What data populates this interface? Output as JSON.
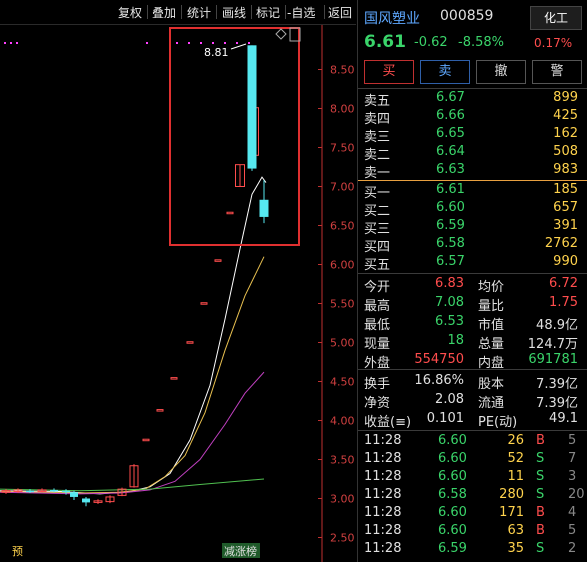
{
  "toolbar": {
    "buttons": [
      "复权",
      "叠加",
      "统计",
      "画线",
      "标记",
      "-自选",
      "返回"
    ]
  },
  "chart": {
    "max_label": "8.81",
    "y_ticks": [
      "8.50",
      "8.00",
      "7.50",
      "7.00",
      "6.50",
      "6.00",
      "5.50",
      "5.00",
      "4.50",
      "4.00",
      "3.50",
      "3.00",
      "2.50"
    ],
    "bottom_left_tag": "预",
    "bottom_tag": "减涨榜",
    "candles": [
      {
        "o": 3.08,
        "c": 3.1,
        "h": 3.12,
        "l": 3.06
      },
      {
        "o": 3.09,
        "c": 3.11,
        "h": 3.13,
        "l": 3.07
      },
      {
        "o": 3.1,
        "c": 3.09,
        "h": 3.12,
        "l": 3.07
      },
      {
        "o": 3.09,
        "c": 3.11,
        "h": 3.13,
        "l": 3.08
      },
      {
        "o": 3.11,
        "c": 3.1,
        "h": 3.13,
        "l": 3.08
      },
      {
        "o": 3.1,
        "c": 3.08,
        "h": 3.12,
        "l": 3.05
      },
      {
        "o": 3.08,
        "c": 3.02,
        "h": 3.1,
        "l": 2.98
      },
      {
        "o": 3.0,
        "c": 2.95,
        "h": 3.02,
        "l": 2.9
      },
      {
        "o": 2.95,
        "c": 2.97,
        "h": 2.99,
        "l": 2.93
      },
      {
        "o": 2.96,
        "c": 3.02,
        "h": 3.04,
        "l": 2.94
      },
      {
        "o": 3.04,
        "c": 3.12,
        "h": 3.14,
        "l": 3.03
      },
      {
        "o": 3.15,
        "c": 3.42,
        "h": 3.44,
        "l": 3.14
      },
      {
        "o": 3.76,
        "c": 3.76,
        "h": 3.76,
        "l": 3.76
      },
      {
        "o": 4.14,
        "c": 4.14,
        "h": 4.14,
        "l": 4.14
      },
      {
        "o": 4.55,
        "c": 4.55,
        "h": 4.55,
        "l": 4.55
      },
      {
        "o": 5.01,
        "c": 5.01,
        "h": 5.01,
        "l": 5.01
      },
      {
        "o": 5.51,
        "c": 5.51,
        "h": 5.51,
        "l": 5.51
      },
      {
        "o": 6.06,
        "c": 6.06,
        "h": 6.06,
        "l": 6.06
      },
      {
        "o": 6.67,
        "c": 6.67,
        "h": 6.67,
        "l": 6.67
      },
      {
        "o": 7.0,
        "c": 7.28,
        "h": 7.28,
        "l": 7.0
      },
      {
        "o": 7.4,
        "c": 8.01,
        "h": 8.01,
        "l": 7.33
      },
      {
        "o": 8.81,
        "c": 7.23,
        "h": 8.81,
        "l": 7.2
      },
      {
        "o": 6.83,
        "c": 6.61,
        "h": 7.08,
        "l": 6.53
      }
    ]
  },
  "stock": {
    "name": "国风塑业",
    "code": "000859",
    "sector_label": "化工",
    "sector_pct": "0.17%",
    "price": "6.61",
    "change": "-0.62",
    "change_pct": "-8.58%"
  },
  "trade_buttons": [
    "买",
    "卖",
    "撤",
    "警"
  ],
  "order_book": {
    "asks": [
      {
        "label": "卖五",
        "price": "6.67",
        "vol": "899"
      },
      {
        "label": "卖四",
        "price": "6.66",
        "vol": "425"
      },
      {
        "label": "卖三",
        "price": "6.65",
        "vol": "162"
      },
      {
        "label": "卖二",
        "price": "6.64",
        "vol": "508"
      },
      {
        "label": "卖一",
        "price": "6.63",
        "vol": "983"
      }
    ],
    "bids": [
      {
        "label": "买一",
        "price": "6.61",
        "vol": "185"
      },
      {
        "label": "买二",
        "price": "6.60",
        "vol": "657"
      },
      {
        "label": "买三",
        "price": "6.59",
        "vol": "391"
      },
      {
        "label": "买四",
        "price": "6.58",
        "vol": "2762"
      },
      {
        "label": "买五",
        "price": "6.57",
        "vol": "990"
      }
    ]
  },
  "stats": [
    {
      "l1": "今开",
      "v1": "6.83",
      "l2": "均价",
      "v2": "6.72"
    },
    {
      "l1": "最高",
      "v1": "7.08",
      "l2": "量比",
      "v2": "1.75"
    },
    {
      "l1": "最低",
      "v1": "6.53",
      "l2": "市值",
      "v2": "48.9亿"
    },
    {
      "l1": "现量",
      "v1": "18",
      "l2": "总量",
      "v2": "124.7万"
    },
    {
      "l1": "外盘",
      "v1": "554750",
      "l2": "内盘",
      "v2": "691781"
    }
  ],
  "stats2": [
    {
      "l1": "换手",
      "v1": "16.86%",
      "l2": "股本",
      "v2": "7.39亿"
    },
    {
      "l1": "净资",
      "v1": "2.08",
      "l2": "流通",
      "v2": "7.39亿"
    },
    {
      "l1": "收益(≡)",
      "v1": "0.101",
      "l2": "PE(动)",
      "v2": "49.1"
    }
  ],
  "trades": [
    {
      "time": "11:28",
      "price": "6.60",
      "vol": "26",
      "side": "B",
      "n": "5"
    },
    {
      "time": "11:28",
      "price": "6.60",
      "vol": "52",
      "side": "S",
      "n": "7"
    },
    {
      "time": "11:28",
      "price": "6.60",
      "vol": "11",
      "side": "S",
      "n": "3"
    },
    {
      "time": "11:28",
      "price": "6.58",
      "vol": "280",
      "side": "S",
      "n": "20"
    },
    {
      "time": "11:28",
      "price": "6.60",
      "vol": "171",
      "side": "B",
      "n": "4"
    },
    {
      "time": "11:28",
      "price": "6.60",
      "vol": "63",
      "side": "B",
      "n": "5"
    },
    {
      "time": "11:28",
      "price": "6.59",
      "vol": "35",
      "side": "S",
      "n": "2"
    }
  ],
  "colors": {
    "up": "#ff4d4d",
    "down": "#3ad46a",
    "down_candle": "#56e8f0",
    "vol": "#ffd34d",
    "highlight": "#e03030"
  }
}
